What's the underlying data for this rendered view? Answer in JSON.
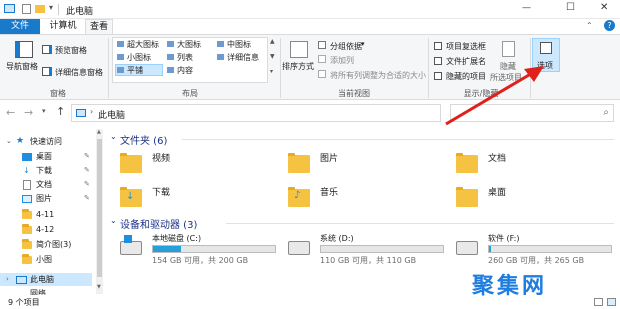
{
  "titlebar": {
    "title": "此电脑",
    "min": "—",
    "max": "☐",
    "close": "✕"
  },
  "tabs": [
    {
      "label": "文件"
    },
    {
      "label": "计算机"
    },
    {
      "label": "查看"
    }
  ],
  "ribbon": {
    "panes": {
      "nav_pane": "导航窗格",
      "preview_pane": "预览窗格",
      "details_pane": "详细信息窗格",
      "group": "窗格"
    },
    "layout": {
      "items": [
        "超大图标",
        "大图标",
        "中图标",
        "小图标",
        "列表",
        "详细信息",
        "平铺",
        "内容"
      ],
      "selected": "平铺",
      "group": "布局"
    },
    "current_view": {
      "sort": "排序方式",
      "group_by": "分组依据",
      "add_column": "添加列",
      "fit_columns": "将所有列调整为合适的大小",
      "group": "当前视图"
    },
    "show_hide": {
      "item_checkboxes": "项目复选框",
      "file_extensions": "文件扩展名",
      "hidden_items": "隐藏的项目",
      "hide": "隐藏",
      "hide_selected": "所选项目",
      "group": "显示/隐藏"
    },
    "options": "选项"
  },
  "address": {
    "path": "此电脑",
    "search_placeholder": ""
  },
  "nav": {
    "quick_access": "快速访问",
    "items": [
      "桌面",
      "下载",
      "文档",
      "图片",
      "4-11",
      "4-12",
      "简介图(3)",
      "小图"
    ],
    "this_pc": "此电脑",
    "network": "网络"
  },
  "content": {
    "folders_header": "文件夹 (6)",
    "folders": [
      "视频",
      "图片",
      "文档",
      "下载",
      "音乐",
      "桌面"
    ],
    "drives_header": "设备和驱动器 (3)",
    "drives": [
      {
        "name": "本地磁盘 (C:)",
        "info": "154 GB 可用，共 200 GB",
        "used_fraction": 0.23
      },
      {
        "name": "系统 (D:)",
        "info": "110 GB 可用，共 110 GB",
        "used_fraction": 0.0
      },
      {
        "name": "软件 (F:)",
        "info": "260 GB 可用，共 265 GB",
        "used_fraction": 0.02
      }
    ]
  },
  "status": {
    "count": "9 个项目"
  },
  "watermark": "聚集网",
  "colors": {
    "accent": "#1979ca",
    "arrow": "#e0201b",
    "watermark": "#1f7de0"
  }
}
